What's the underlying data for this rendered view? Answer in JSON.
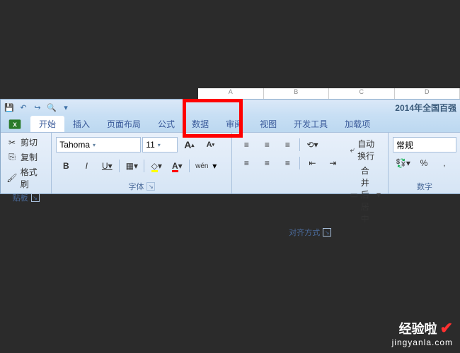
{
  "title": "2014年全国百强",
  "sheet_cols": [
    "A",
    "B",
    "C",
    "D"
  ],
  "partial_left": "板",
  "office_color": "#2a7a2a",
  "qat": {
    "save": "💾",
    "undo": "↶",
    "redo": "↷",
    "print": "🔍",
    "more": "▾"
  },
  "tabs": [
    {
      "label": "开始",
      "active": true
    },
    {
      "label": "插入",
      "active": false
    },
    {
      "label": "页面布局",
      "active": false
    },
    {
      "label": "公式",
      "active": false
    },
    {
      "label": "数据",
      "active": false
    },
    {
      "label": "审阅",
      "active": false
    },
    {
      "label": "视图",
      "active": false
    },
    {
      "label": "开发工具",
      "active": false
    },
    {
      "label": "加载项",
      "active": false
    }
  ],
  "clipboard": {
    "cut": "剪切",
    "copy": "复制",
    "paste_fmt": "格式刷",
    "group_label": "贴板"
  },
  "font": {
    "name": "Tahoma",
    "size": "11",
    "incr": "A",
    "decr": "A",
    "bold": "B",
    "italic": "I",
    "underline": "U",
    "pinyin": "wén",
    "group_label": "字体"
  },
  "alignment": {
    "wrap": "自动换行",
    "merge": "合并后居中",
    "group_label": "对齐方式"
  },
  "number": {
    "format": "常规",
    "percent": "%",
    "comma": ",",
    "group_label": "数字"
  },
  "watermark": {
    "brand": "经验啦",
    "domain": "jingyanla.com"
  }
}
